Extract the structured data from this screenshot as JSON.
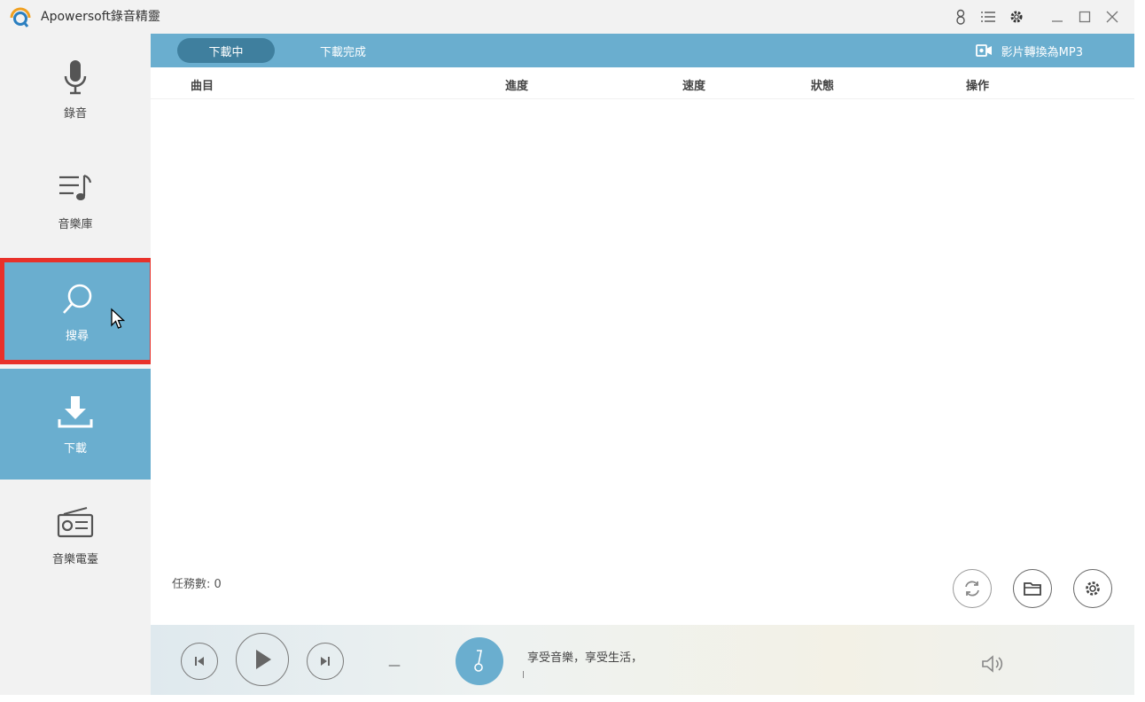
{
  "app": {
    "title": "Apowersoft錄音精靈"
  },
  "titlebar": {
    "icons": [
      "user-icon",
      "list-icon",
      "gear-icon",
      "minimize-icon",
      "maximize-icon",
      "close-icon"
    ]
  },
  "sidebar": {
    "items": [
      {
        "label": "錄音",
        "icon": "microphone-icon"
      },
      {
        "label": "音樂庫",
        "icon": "music-library-icon"
      },
      {
        "label": "搜尋",
        "icon": "search-icon"
      },
      {
        "label": "下載",
        "icon": "download-icon"
      },
      {
        "label": "音樂電臺",
        "icon": "radio-icon"
      }
    ]
  },
  "tabs": [
    {
      "label": "下載中",
      "active": true
    },
    {
      "label": "下載完成",
      "active": false
    }
  ],
  "convert": {
    "label": "影片轉換為MP3"
  },
  "table": {
    "columns": [
      "曲目",
      "進度",
      "速度",
      "狀態",
      "操作"
    ]
  },
  "footer": {
    "task_count": "任務數: 0"
  },
  "player": {
    "track": "—",
    "now_playing": "享受音樂，享受生活，"
  },
  "colors": {
    "accent": "#6aaecf",
    "accent_dark": "#3f7f9e",
    "highlight": "#e8312a"
  }
}
